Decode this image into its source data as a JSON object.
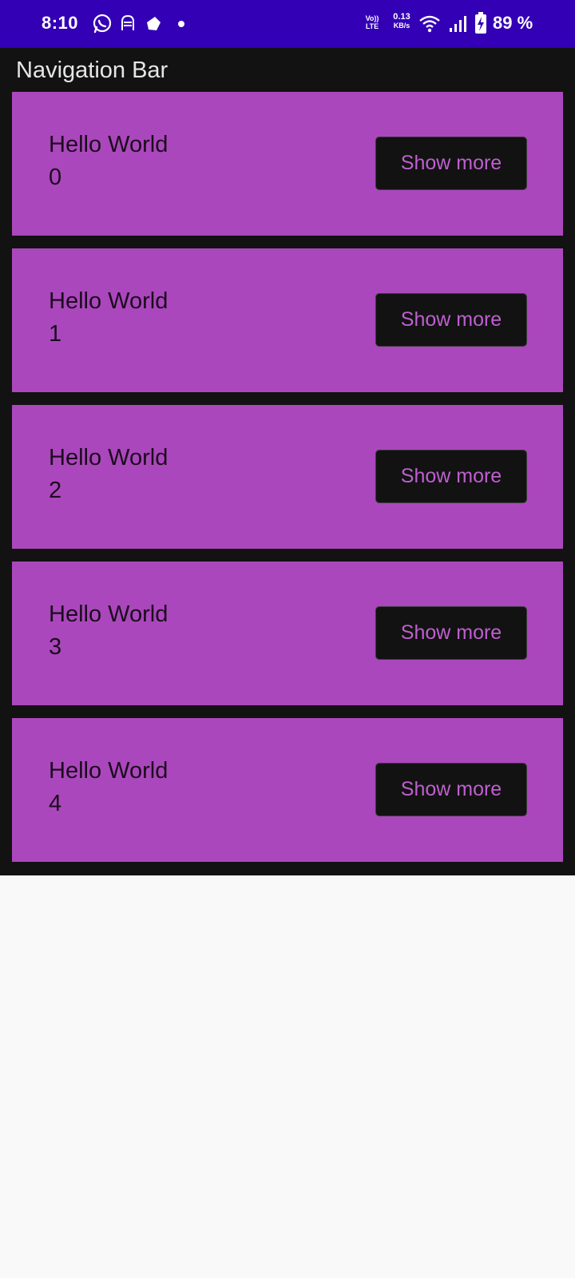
{
  "status_bar": {
    "time": "8:10",
    "volte_line1": "Vo))",
    "volte_line2": "LTE",
    "net_speed": "0.13",
    "net_speed_unit": "KB/s",
    "battery_percent": "89 %",
    "background_color": "#3300b6",
    "icons": [
      "whatsapp-icon",
      "snapchat-ghost-icon",
      "app-notification-icon",
      "notification-dot-icon",
      "volte-icon",
      "wifi-icon",
      "signal-icon",
      "battery-charging-icon"
    ]
  },
  "toolbar": {
    "title": "Navigation Bar"
  },
  "list": {
    "items": [
      {
        "title": "Hello World",
        "index": "0",
        "button_label": "Show more"
      },
      {
        "title": "Hello World",
        "index": "1",
        "button_label": "Show more"
      },
      {
        "title": "Hello World",
        "index": "2",
        "button_label": "Show more"
      },
      {
        "title": "Hello World",
        "index": "3",
        "button_label": "Show more"
      },
      {
        "title": "Hello World",
        "index": "4",
        "button_label": "Show more"
      }
    ]
  },
  "colors": {
    "card_background": "#ab47bc",
    "app_background": "#121212",
    "button_text": "#bf5fd0"
  }
}
